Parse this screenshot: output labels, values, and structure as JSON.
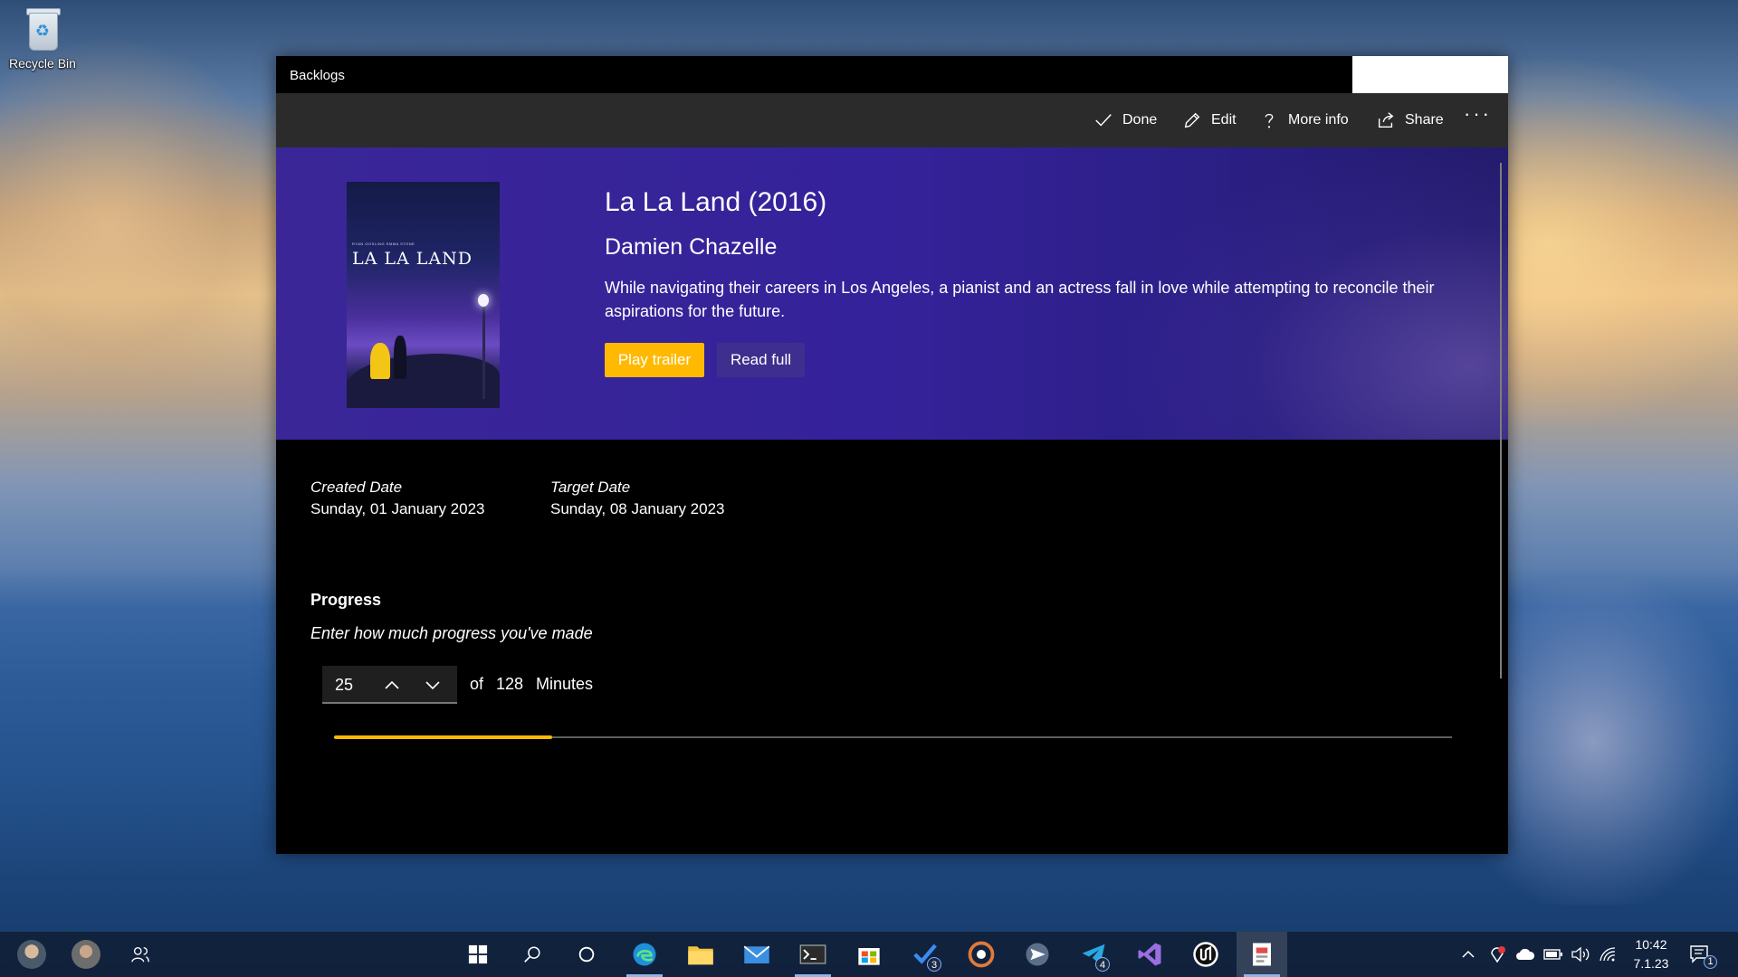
{
  "desktop": {
    "recycle_bin_label": "Recycle Bin"
  },
  "window": {
    "title": "Backlogs"
  },
  "toolbar": {
    "done_label": "Done",
    "edit_label": "Edit",
    "more_info_label": "More info",
    "share_label": "Share",
    "overflow_label": "···"
  },
  "movie": {
    "title": "La La Land (2016)",
    "director": "Damien Chazelle",
    "description": "While navigating their careers in Los Angeles, a pianist and an actress fall in love while attempting to reconcile their aspirations for the future.",
    "play_trailer_label": "Play trailer",
    "read_full_label": "Read full",
    "poster": {
      "title": "LA LA LAND",
      "cast": "RYAN GOSLING   EMMA STONE"
    }
  },
  "dates": {
    "created_label": "Created Date",
    "created_value": "Sunday, 01 January 2023",
    "target_label": "Target Date",
    "target_value": "Sunday, 08 January 2023"
  },
  "progress": {
    "heading": "Progress",
    "hint": "Enter how much progress you've made",
    "current": "25",
    "of_label": "of",
    "total": "128",
    "unit": "Minutes",
    "fraction": 0.195
  },
  "taskbar": {
    "badges": {
      "todo": "3",
      "telegram": "4"
    },
    "clock_time": "10:42",
    "clock_date": "7.1.23",
    "notification_count": "1"
  },
  "colors": {
    "accent": "#ffb900",
    "hero_purple": "#34229a",
    "command_bar": "#2b2b2b"
  }
}
